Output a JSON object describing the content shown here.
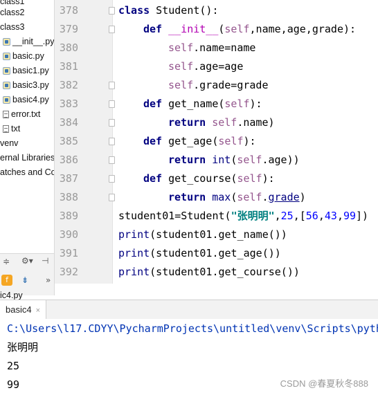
{
  "sidebar": {
    "items": [
      {
        "label": "class1",
        "icon": "folder-icon"
      },
      {
        "label": "class2",
        "icon": "folder-icon"
      },
      {
        "label": "class3",
        "icon": "folder-icon"
      },
      {
        "label": "__init__.py",
        "icon": "python-file-icon"
      },
      {
        "label": "basic.py",
        "icon": "python-file-icon"
      },
      {
        "label": "basic1.py",
        "icon": "python-file-icon"
      },
      {
        "label": "basic3.py",
        "icon": "python-file-icon"
      },
      {
        "label": "basic4.py",
        "icon": "python-file-icon"
      },
      {
        "label": "error.txt",
        "icon": "text-file-icon"
      },
      {
        "label": "txt",
        "icon": "text-file-icon"
      },
      {
        "label": "venv",
        "icon": "folder-icon"
      },
      {
        "label": "ernal Libraries",
        "icon": "library-icon"
      },
      {
        "label": "atches and Co",
        "icon": "scratches-icon"
      }
    ],
    "bottom_file": "ic4.py"
  },
  "editor": {
    "line_numbers": [
      "378",
      "379",
      "380",
      "381",
      "382",
      "383",
      "384",
      "385",
      "386",
      "387",
      "388",
      "389",
      "390",
      "391",
      "392"
    ]
  },
  "run": {
    "tab_label": "basic4",
    "close_label": "×",
    "output": [
      "C:\\Users\\l17.CDYY\\PycharmProjects\\untitled\\venv\\Scripts\\pyth",
      "张明明",
      "25",
      "99"
    ]
  },
  "watermark": "CSDN @春夏秋冬888",
  "colors": {
    "keyword": "#000080",
    "self": "#94558d",
    "string": "#008080",
    "number": "#0000ff",
    "line_number": "#999999",
    "console_path": "#0033b3"
  }
}
